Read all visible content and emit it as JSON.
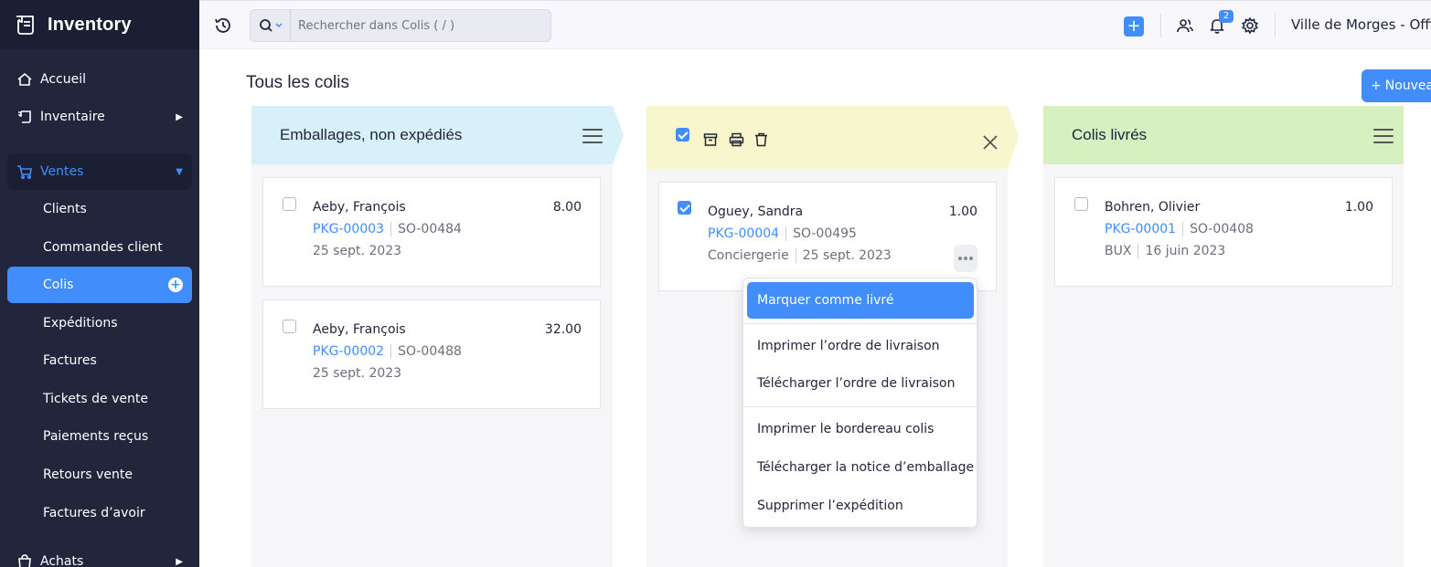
{
  "app": {
    "title": "Inventory"
  },
  "sidebar": {
    "items": [
      {
        "label": "Accueil",
        "icon": "home-icon"
      },
      {
        "label": "Inventaire",
        "icon": "basket-icon"
      },
      {
        "label": "Ventes",
        "icon": "cart-icon"
      },
      {
        "label": "Achats",
        "icon": "bag-icon"
      }
    ],
    "sales_subitems": [
      {
        "label": "Clients"
      },
      {
        "label": "Commandes client"
      },
      {
        "label": "Colis"
      },
      {
        "label": "Expéditions"
      },
      {
        "label": "Factures"
      },
      {
        "label": "Tickets de vente"
      },
      {
        "label": "Paiements reçus"
      },
      {
        "label": "Retours vente"
      },
      {
        "label": "Factures d’avoir"
      }
    ]
  },
  "topbar": {
    "search_placeholder": "Rechercher dans Colis ( / )",
    "notification_count": "2",
    "organization": "Ville de Morges - Office",
    "add_label": "+"
  },
  "main": {
    "title": "Tous les colis",
    "new_button": "Nouveau",
    "columns": [
      {
        "title": "Emballages, non expédiés",
        "color": "#d8f0f8",
        "cards": [
          {
            "customer": "Aeby, François",
            "amount": "8.00",
            "package": "PKG-00003",
            "order": "SO-00484",
            "date": "25 sept. 2023"
          },
          {
            "customer": "Aeby, François",
            "amount": "32.00",
            "package": "PKG-00002",
            "order": "SO-00488",
            "date": "25 sept. 2023"
          }
        ]
      },
      {
        "title": "",
        "color": "#f8f6cc",
        "cards": [
          {
            "customer": "Oguey, Sandra",
            "amount": "1.00",
            "package": "PKG-00004",
            "order": "SO-00495",
            "carrier": "Conciergerie",
            "date": "25 sept. 2023",
            "checked": true
          }
        ]
      },
      {
        "title": "Colis livrés",
        "color": "#d6f0c0",
        "cards": [
          {
            "customer": "Bohren, Olivier",
            "amount": "1.00",
            "package": "PKG-00001",
            "order": "SO-00408",
            "carrier": "BUX",
            "date": "16 juin 2023"
          }
        ]
      }
    ],
    "dropdown": [
      "Marquer comme livré",
      "Imprimer l’ordre de livraison",
      "Télécharger l’ordre de livraison",
      "Imprimer le bordereau colis",
      "Télécharger la notice d’emballage",
      "Supprimer l’expédition"
    ]
  },
  "colors": {
    "accent": "#408dfb",
    "sidebar": "#21263c"
  }
}
